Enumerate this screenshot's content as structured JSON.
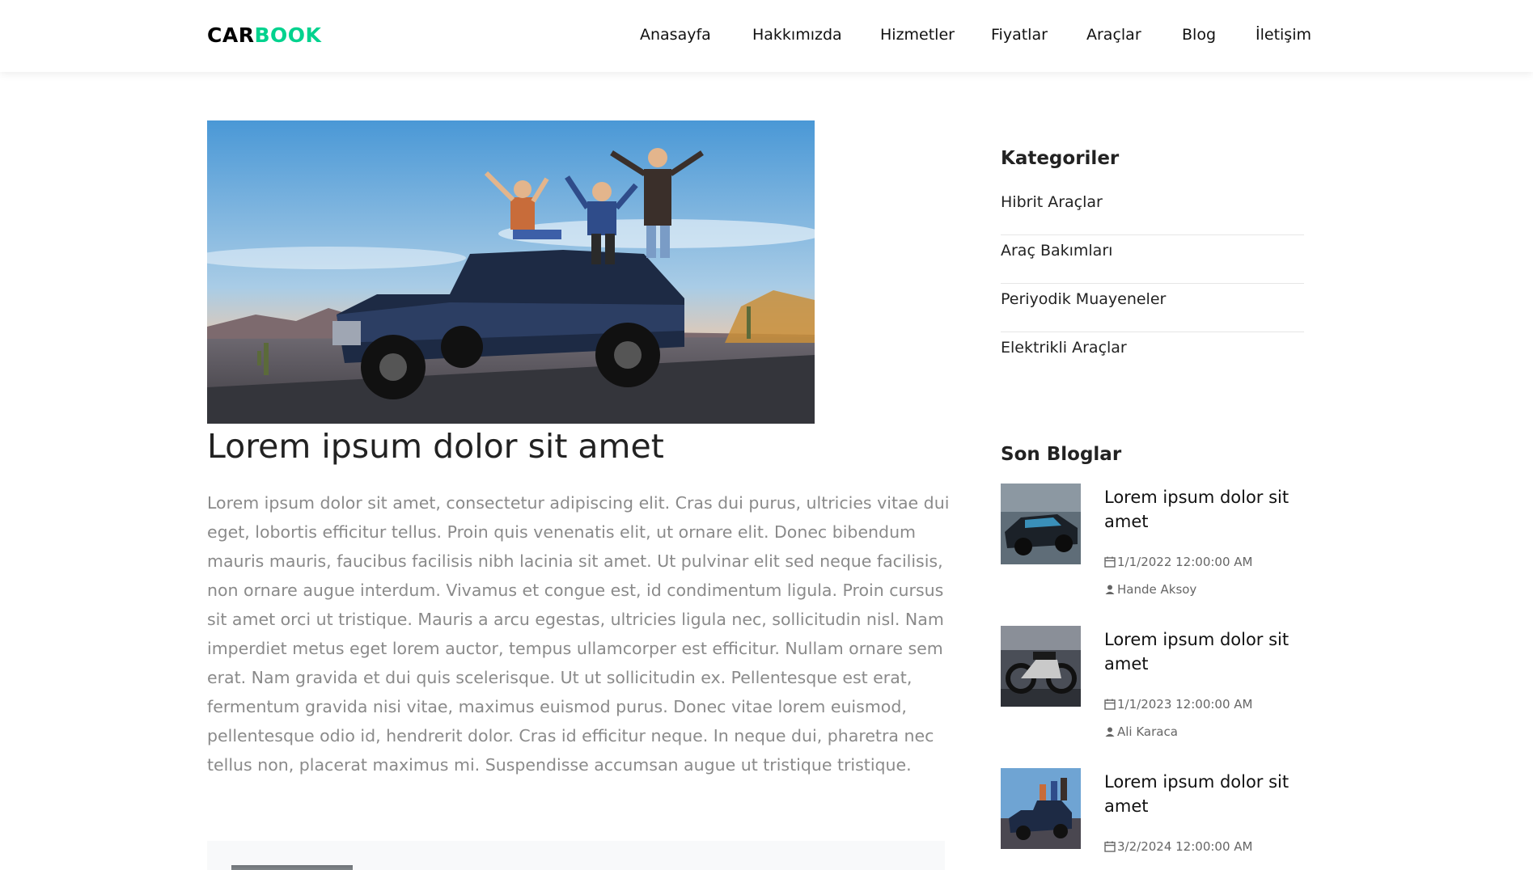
{
  "brand": {
    "part1": "CAR",
    "part2": "BOOK",
    "accent_color": "#01d28e"
  },
  "nav": {
    "items": [
      "Anasayfa",
      "Hakkımızda",
      "Hizmetler",
      "Fiyatlar",
      "Araçlar",
      "Blog",
      "İletişim"
    ]
  },
  "post": {
    "image": "jeep-with-friends-photo",
    "title": "Lorem ipsum dolor sit amet",
    "body": "Lorem ipsum dolor sit amet, consectetur adipiscing elit. Cras dui purus, ultricies vitae dui eget, lobortis efficitur tellus. Proin quis venenatis elit, ut ornare elit. Donec bibendum mauris mauris, faucibus facilisis nibh lacinia sit amet. Ut pulvinar elit sed neque facilisis, non ornare augue interdum. Vivamus et congue est, id condimentum ligula. Proin cursus sit amet orci ut tristique. Mauris a arcu egestas, ultricies ligula nec, sollicitudin nisl. Nam imperdiet metus eget lorem auctor, tempus ullamcorper est efficitur. Nullam ornare sem erat. Nam gravida et dui quis scelerisque. Ut ut sollicitudin ex. Pellentesque est erat, fermentum gravida nisi vitae, maximus euismod purus. Donec vitae lorem euismod, pellentesque odio id, hendrerit dolor. Cras id efficitur neque. In neque dui, pharetra nec tellus non, placerat maximus mi. Suspendisse accumsan augue ut tristique tristique."
  },
  "sidebar": {
    "categories_heading": "Kategoriler",
    "categories": [
      "Hibrit Araçlar",
      "Araç Bakımları",
      "Periyodik Muayeneler",
      "Elektrikli Araçlar"
    ],
    "recent_heading": "Son Bloglar",
    "recent": [
      {
        "title": "Lorem ipsum dolor sit amet",
        "date": "1/1/2022 12:00:00 AM",
        "author": "Hande Aksoy",
        "icon": "sports-car-photo"
      },
      {
        "title": "Lorem ipsum dolor sit amet",
        "date": "1/1/2023 12:00:00 AM",
        "author": "Ali Karaca",
        "icon": "motorcycle-photo"
      },
      {
        "title": "Lorem ipsum dolor sit amet",
        "date": "3/2/2024 12:00:00 AM",
        "author": "",
        "icon": "jeep-photo"
      }
    ]
  }
}
